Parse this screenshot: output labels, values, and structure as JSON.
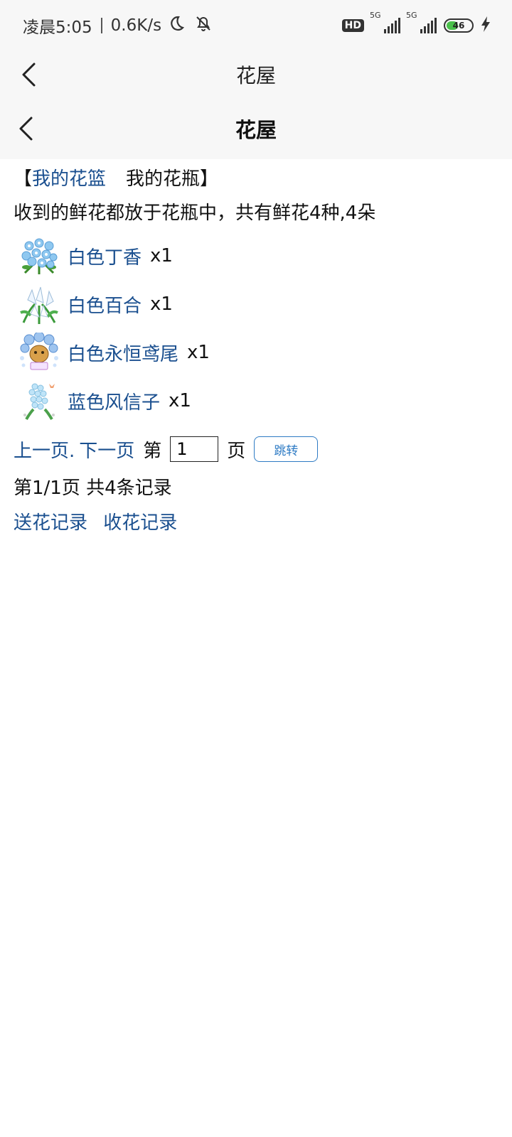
{
  "status_bar": {
    "time": "凌晨5:05",
    "speed": "0.6K/s",
    "hd_label": "HD",
    "sim1_label": "5G",
    "sim2_label": "5G",
    "battery_percent": "46",
    "battery_level": 0.46,
    "battery_color": "#49c04a"
  },
  "nav_outer": {
    "title": "花屋"
  },
  "nav_inner": {
    "title": "花屋"
  },
  "tabs": {
    "open_bracket": "【",
    "basket": "我的花篮",
    "vase": "我的花瓶",
    "close_bracket": "】"
  },
  "description": "收到的鲜花都放于花瓶中，共有鲜花4种,4朵",
  "flowers": [
    {
      "name": "白色丁香",
      "qty": "x1",
      "icon": "flower-cluster-blue-icon"
    },
    {
      "name": "白色百合",
      "qty": "x1",
      "icon": "lily-white-icon"
    },
    {
      "name": "白色永恒鸢尾",
      "qty": "x1",
      "icon": "iris-bouquet-icon"
    },
    {
      "name": "蓝色风信子",
      "qty": "x1",
      "icon": "hyacinth-icon"
    }
  ],
  "pager": {
    "prev": "上一页.",
    "next": "下一页",
    "page_prefix": "第",
    "page_value": "1",
    "page_suffix": "页",
    "jump": "跳转"
  },
  "page_info": "第1/1页 共4条记录",
  "records": {
    "send": "送花记录",
    "receive": "收花记录"
  },
  "colors": {
    "link": "#1a4f8f",
    "button_border": "#2e7bc4",
    "header_bg": "#f7f7f7"
  }
}
